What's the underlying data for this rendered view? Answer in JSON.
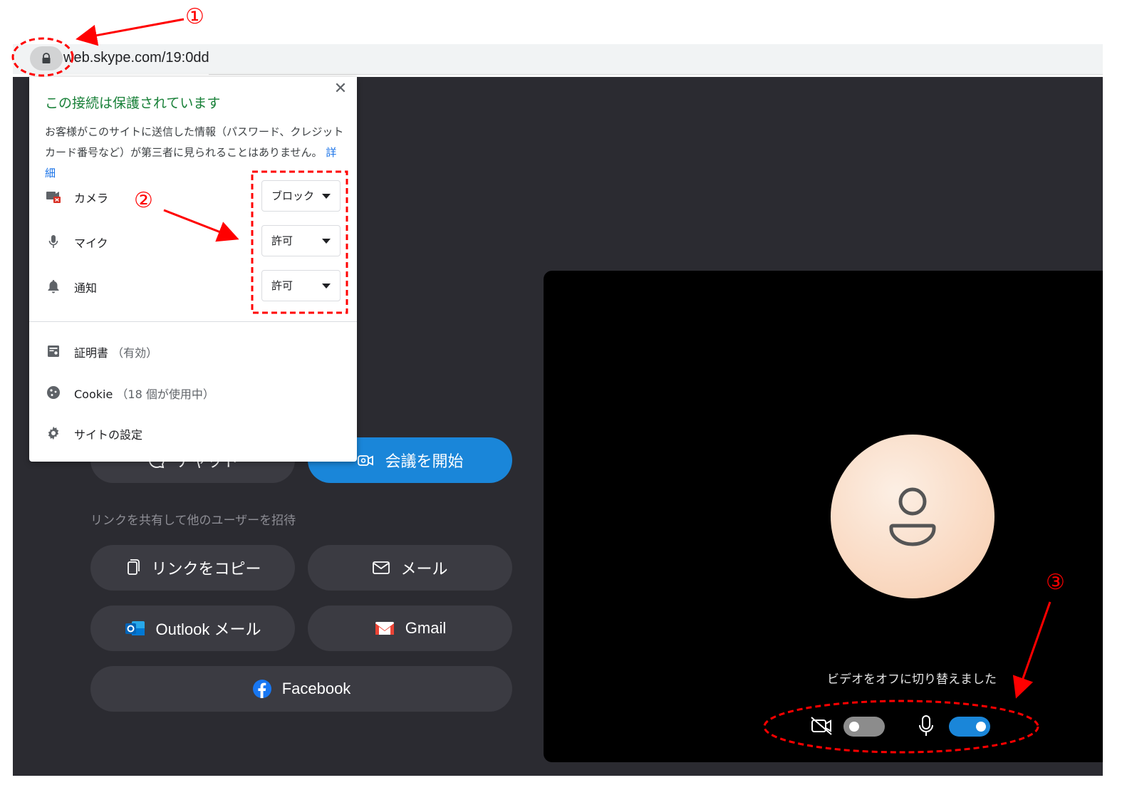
{
  "browser": {
    "url": "web.skype.com/19:0dd",
    "lock_icon": "lock-icon"
  },
  "popup": {
    "title": "この接続は保護されています",
    "description": "お客様がこのサイトに送信した情報（パスワード、クレジット カード番号など）が第三者に見られることはありません。",
    "details_link": "詳細",
    "close": "✕",
    "permissions": [
      {
        "label": "カメラ",
        "value": "ブロック",
        "icon": "camera-blocked-icon"
      },
      {
        "label": "マイク",
        "value": "許可",
        "icon": "mic-icon"
      },
      {
        "label": "通知",
        "value": "許可",
        "icon": "bell-icon"
      }
    ],
    "certificate": {
      "label": "証明書",
      "status": "（有効）"
    },
    "cookie": {
      "label": "Cookie",
      "status": "（18 個が使用中）"
    },
    "site_settings": "サイトの設定"
  },
  "app": {
    "chat_button": "チャット",
    "start_meeting": "会議を開始",
    "share_label": "リンクを共有して他のユーザーを招待",
    "copy_link": "リンクをコピー",
    "email": "メール",
    "outlook": "Outlook メール",
    "gmail": "Gmail",
    "facebook": "Facebook"
  },
  "video": {
    "status_text": "ビデオをオフに切り替えました",
    "video_toggle_on": false,
    "mic_toggle_on": true
  },
  "annotations": {
    "one": "①",
    "two": "②",
    "three": "③",
    "color": "#ff0000"
  },
  "colors": {
    "app_bg": "#2b2b31",
    "primary": "#1a86d9",
    "secure_green": "#188038",
    "link_blue": "#1a73e8"
  }
}
